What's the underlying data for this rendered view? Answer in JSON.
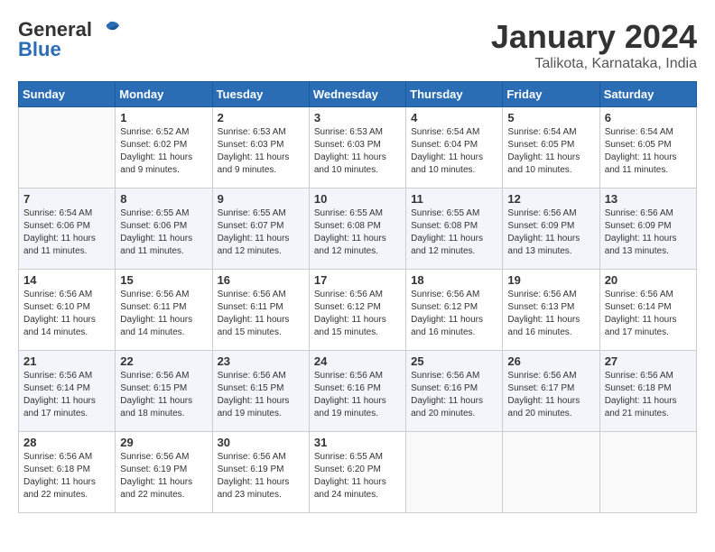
{
  "header": {
    "logo_general": "General",
    "logo_blue": "Blue",
    "month_title": "January 2024",
    "location": "Talikota, Karnataka, India"
  },
  "weekdays": [
    "Sunday",
    "Monday",
    "Tuesday",
    "Wednesday",
    "Thursday",
    "Friday",
    "Saturday"
  ],
  "weeks": [
    [
      {
        "day": "",
        "sunrise": "",
        "sunset": "",
        "daylight": ""
      },
      {
        "day": "1",
        "sunrise": "Sunrise: 6:52 AM",
        "sunset": "Sunset: 6:02 PM",
        "daylight": "Daylight: 11 hours and 9 minutes."
      },
      {
        "day": "2",
        "sunrise": "Sunrise: 6:53 AM",
        "sunset": "Sunset: 6:03 PM",
        "daylight": "Daylight: 11 hours and 9 minutes."
      },
      {
        "day": "3",
        "sunrise": "Sunrise: 6:53 AM",
        "sunset": "Sunset: 6:03 PM",
        "daylight": "Daylight: 11 hours and 10 minutes."
      },
      {
        "day": "4",
        "sunrise": "Sunrise: 6:54 AM",
        "sunset": "Sunset: 6:04 PM",
        "daylight": "Daylight: 11 hours and 10 minutes."
      },
      {
        "day": "5",
        "sunrise": "Sunrise: 6:54 AM",
        "sunset": "Sunset: 6:05 PM",
        "daylight": "Daylight: 11 hours and 10 minutes."
      },
      {
        "day": "6",
        "sunrise": "Sunrise: 6:54 AM",
        "sunset": "Sunset: 6:05 PM",
        "daylight": "Daylight: 11 hours and 11 minutes."
      }
    ],
    [
      {
        "day": "7",
        "sunrise": "Sunrise: 6:54 AM",
        "sunset": "Sunset: 6:06 PM",
        "daylight": "Daylight: 11 hours and 11 minutes."
      },
      {
        "day": "8",
        "sunrise": "Sunrise: 6:55 AM",
        "sunset": "Sunset: 6:06 PM",
        "daylight": "Daylight: 11 hours and 11 minutes."
      },
      {
        "day": "9",
        "sunrise": "Sunrise: 6:55 AM",
        "sunset": "Sunset: 6:07 PM",
        "daylight": "Daylight: 11 hours and 12 minutes."
      },
      {
        "day": "10",
        "sunrise": "Sunrise: 6:55 AM",
        "sunset": "Sunset: 6:08 PM",
        "daylight": "Daylight: 11 hours and 12 minutes."
      },
      {
        "day": "11",
        "sunrise": "Sunrise: 6:55 AM",
        "sunset": "Sunset: 6:08 PM",
        "daylight": "Daylight: 11 hours and 12 minutes."
      },
      {
        "day": "12",
        "sunrise": "Sunrise: 6:56 AM",
        "sunset": "Sunset: 6:09 PM",
        "daylight": "Daylight: 11 hours and 13 minutes."
      },
      {
        "day": "13",
        "sunrise": "Sunrise: 6:56 AM",
        "sunset": "Sunset: 6:09 PM",
        "daylight": "Daylight: 11 hours and 13 minutes."
      }
    ],
    [
      {
        "day": "14",
        "sunrise": "Sunrise: 6:56 AM",
        "sunset": "Sunset: 6:10 PM",
        "daylight": "Daylight: 11 hours and 14 minutes."
      },
      {
        "day": "15",
        "sunrise": "Sunrise: 6:56 AM",
        "sunset": "Sunset: 6:11 PM",
        "daylight": "Daylight: 11 hours and 14 minutes."
      },
      {
        "day": "16",
        "sunrise": "Sunrise: 6:56 AM",
        "sunset": "Sunset: 6:11 PM",
        "daylight": "Daylight: 11 hours and 15 minutes."
      },
      {
        "day": "17",
        "sunrise": "Sunrise: 6:56 AM",
        "sunset": "Sunset: 6:12 PM",
        "daylight": "Daylight: 11 hours and 15 minutes."
      },
      {
        "day": "18",
        "sunrise": "Sunrise: 6:56 AM",
        "sunset": "Sunset: 6:12 PM",
        "daylight": "Daylight: 11 hours and 16 minutes."
      },
      {
        "day": "19",
        "sunrise": "Sunrise: 6:56 AM",
        "sunset": "Sunset: 6:13 PM",
        "daylight": "Daylight: 11 hours and 16 minutes."
      },
      {
        "day": "20",
        "sunrise": "Sunrise: 6:56 AM",
        "sunset": "Sunset: 6:14 PM",
        "daylight": "Daylight: 11 hours and 17 minutes."
      }
    ],
    [
      {
        "day": "21",
        "sunrise": "Sunrise: 6:56 AM",
        "sunset": "Sunset: 6:14 PM",
        "daylight": "Daylight: 11 hours and 17 minutes."
      },
      {
        "day": "22",
        "sunrise": "Sunrise: 6:56 AM",
        "sunset": "Sunset: 6:15 PM",
        "daylight": "Daylight: 11 hours and 18 minutes."
      },
      {
        "day": "23",
        "sunrise": "Sunrise: 6:56 AM",
        "sunset": "Sunset: 6:15 PM",
        "daylight": "Daylight: 11 hours and 19 minutes."
      },
      {
        "day": "24",
        "sunrise": "Sunrise: 6:56 AM",
        "sunset": "Sunset: 6:16 PM",
        "daylight": "Daylight: 11 hours and 19 minutes."
      },
      {
        "day": "25",
        "sunrise": "Sunrise: 6:56 AM",
        "sunset": "Sunset: 6:16 PM",
        "daylight": "Daylight: 11 hours and 20 minutes."
      },
      {
        "day": "26",
        "sunrise": "Sunrise: 6:56 AM",
        "sunset": "Sunset: 6:17 PM",
        "daylight": "Daylight: 11 hours and 20 minutes."
      },
      {
        "day": "27",
        "sunrise": "Sunrise: 6:56 AM",
        "sunset": "Sunset: 6:18 PM",
        "daylight": "Daylight: 11 hours and 21 minutes."
      }
    ],
    [
      {
        "day": "28",
        "sunrise": "Sunrise: 6:56 AM",
        "sunset": "Sunset: 6:18 PM",
        "daylight": "Daylight: 11 hours and 22 minutes."
      },
      {
        "day": "29",
        "sunrise": "Sunrise: 6:56 AM",
        "sunset": "Sunset: 6:19 PM",
        "daylight": "Daylight: 11 hours and 22 minutes."
      },
      {
        "day": "30",
        "sunrise": "Sunrise: 6:56 AM",
        "sunset": "Sunset: 6:19 PM",
        "daylight": "Daylight: 11 hours and 23 minutes."
      },
      {
        "day": "31",
        "sunrise": "Sunrise: 6:55 AM",
        "sunset": "Sunset: 6:20 PM",
        "daylight": "Daylight: 11 hours and 24 minutes."
      },
      {
        "day": "",
        "sunrise": "",
        "sunset": "",
        "daylight": ""
      },
      {
        "day": "",
        "sunrise": "",
        "sunset": "",
        "daylight": ""
      },
      {
        "day": "",
        "sunrise": "",
        "sunset": "",
        "daylight": ""
      }
    ]
  ]
}
